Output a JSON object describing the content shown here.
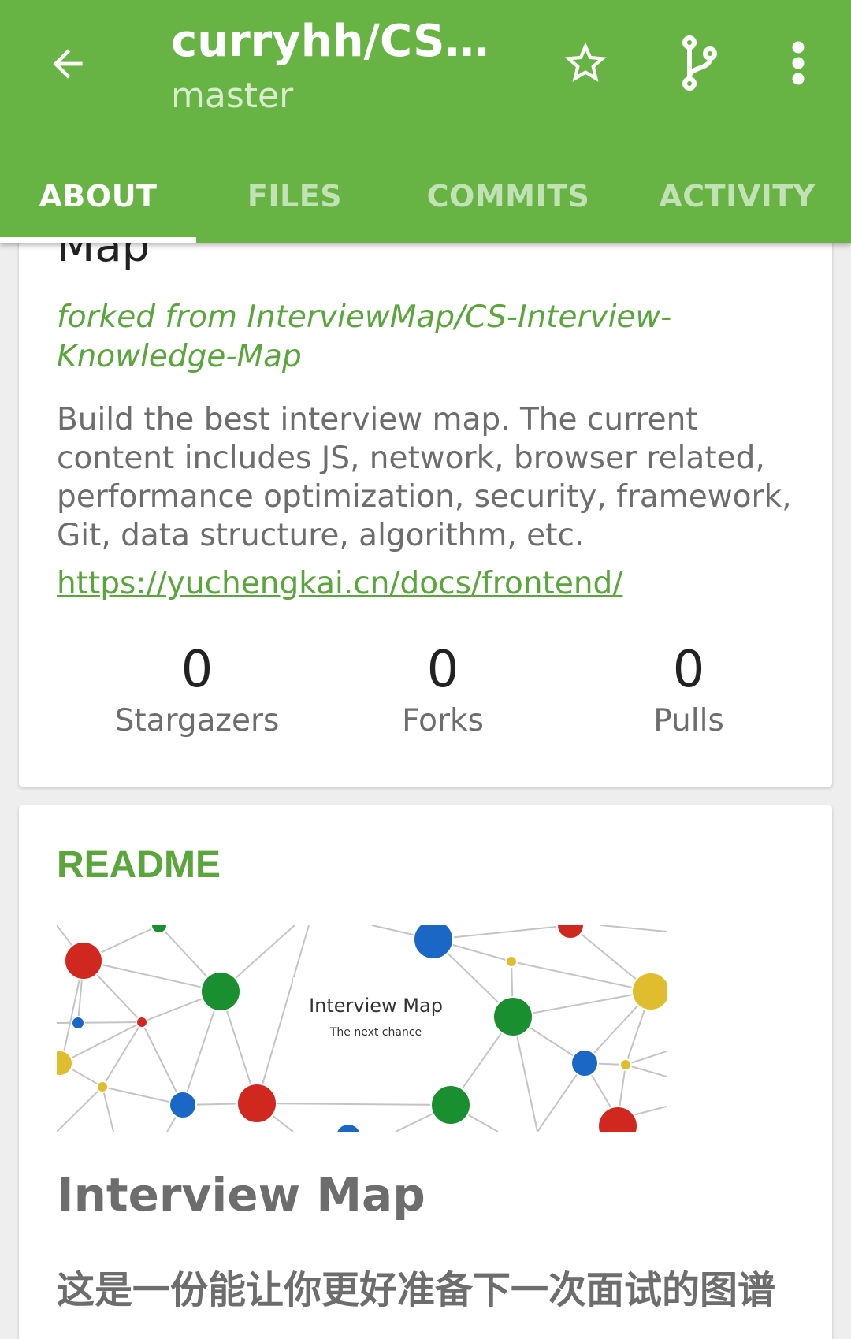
{
  "appbar": {
    "title": "curryhh/CS-In…",
    "subtitle": "master",
    "back_icon": "arrow-left-icon",
    "star_icon": "star-outline-icon",
    "branch_icon": "git-branch-icon",
    "more_icon": "more-vertical-icon",
    "color": "#67b445"
  },
  "tabs": [
    {
      "label": "ABOUT",
      "active": true
    },
    {
      "label": "FILES",
      "active": false
    },
    {
      "label": "COMMITS",
      "active": false
    },
    {
      "label": "ACTIVITY",
      "active": false
    }
  ],
  "about": {
    "repo_name": "Map",
    "fork_note": "forked from InterviewMap/CS-Interview-Knowledge-Map",
    "description": "Build the best interview map. The current content includes JS, network, browser related, performance optimization, security, framework, Git, data structure, algorithm, etc.",
    "homepage": "https://yuchengkai.cn/docs/frontend/",
    "stats": [
      {
        "value": "0",
        "label": "Stargazers"
      },
      {
        "value": "0",
        "label": "Forks"
      },
      {
        "value": "0",
        "label": "Pulls"
      }
    ]
  },
  "readme": {
    "label": "README",
    "image": {
      "title": "Interview Map",
      "subtitle": "The next chance"
    },
    "heading": "Interview Map",
    "paragraph": "这是一份能让你更好准备下一次面试的图谱"
  },
  "colors": {
    "accent": "#5aa53c",
    "secondary_text": "#6d6d6d",
    "node_red": "#d0281f",
    "node_green": "#1a8f2f",
    "node_blue": "#1b67c6",
    "node_yellow": "#dfbd2e"
  }
}
